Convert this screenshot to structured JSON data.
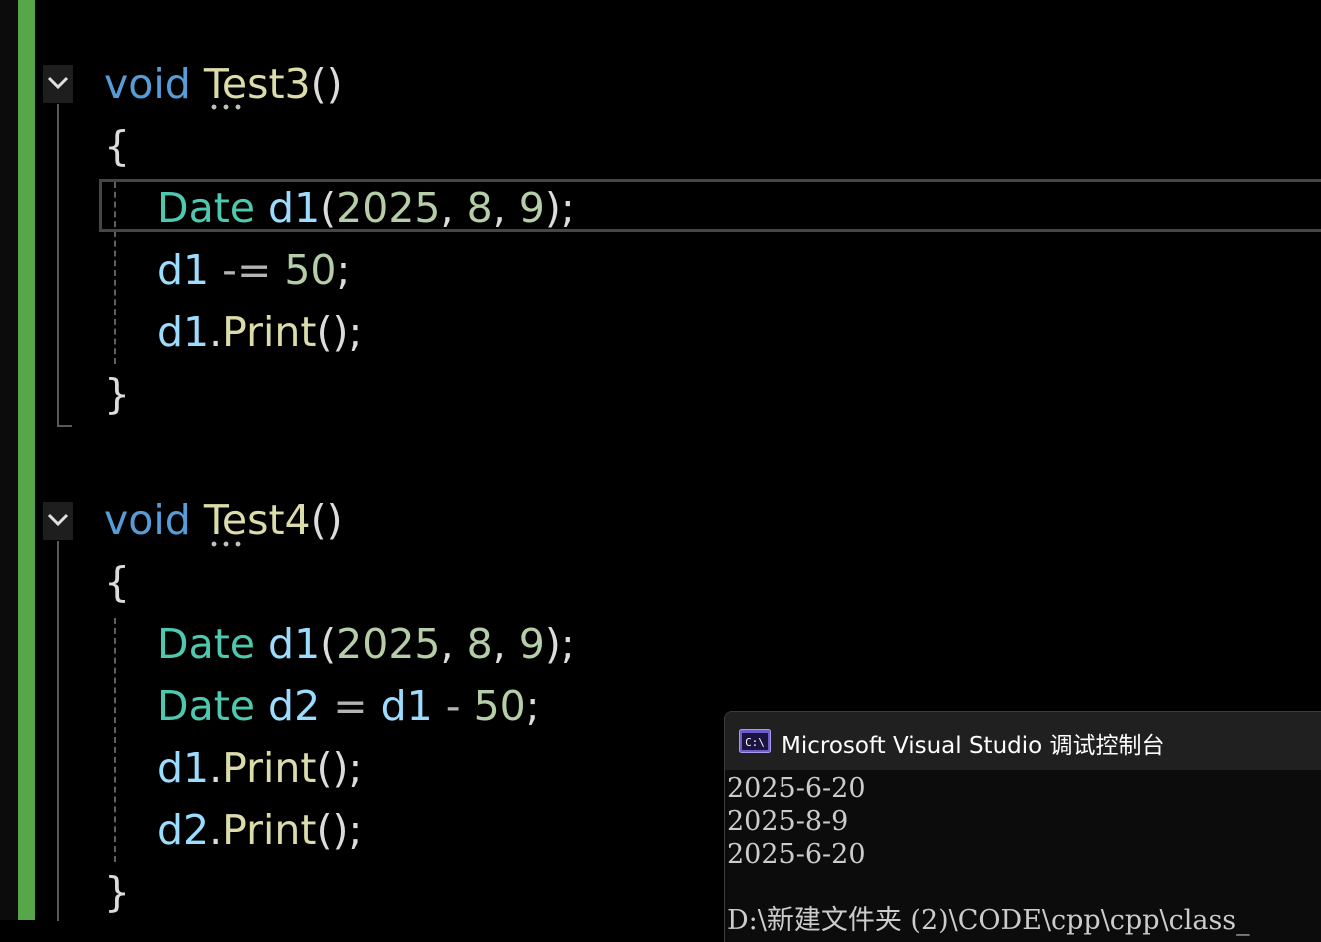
{
  "editor": {
    "test3": {
      "keyword": "void",
      "name": "Test3",
      "parens": "()",
      "open_brace": "{",
      "close_brace": "}",
      "lines": [
        {
          "type": "Date",
          "var": "d1",
          "rest": "(",
          "a": "2025",
          "s1": ", ",
          "b": "8",
          "s2": ", ",
          "c": "9",
          "end": ");"
        },
        {
          "var": "d1",
          "op": " -= ",
          "num": "50",
          "end": ";"
        },
        {
          "var": "d1",
          "dot": ".",
          "fn": "Print",
          "end": "();"
        }
      ]
    },
    "test4": {
      "keyword": "void",
      "name": "Test4",
      "parens": "()",
      "open_brace": "{",
      "close_brace": "}",
      "lines": [
        {
          "type": "Date",
          "var": "d1",
          "rest": "(",
          "a": "2025",
          "s1": ", ",
          "b": "8",
          "s2": ", ",
          "c": "9",
          "end": ");"
        },
        {
          "type": "Date",
          "var": "d2",
          "eq": " = ",
          "var2": "d1",
          "op": " - ",
          "num": "50",
          "end": ";"
        },
        {
          "var": "d1",
          "dot": ".",
          "fn": "Print",
          "end": "();"
        },
        {
          "var": "d2",
          "dot": ".",
          "fn": "Print",
          "end": "();"
        }
      ]
    }
  },
  "console": {
    "title": "Microsoft Visual Studio 调试控制台",
    "icon": "console-app-icon",
    "output": [
      "2025-6-20",
      "2025-8-9",
      "2025-6-20",
      "",
      "D:\\新建文件夹 (2)\\CODE\\cpp\\cpp\\class_"
    ]
  },
  "colors": {
    "background": "#000000",
    "keyword": "#569cd6",
    "function": "#dcdcaa",
    "type": "#4ec9b0",
    "variable": "#9cdcfe",
    "number": "#b5cea8",
    "change_bar": "#57a64a"
  }
}
